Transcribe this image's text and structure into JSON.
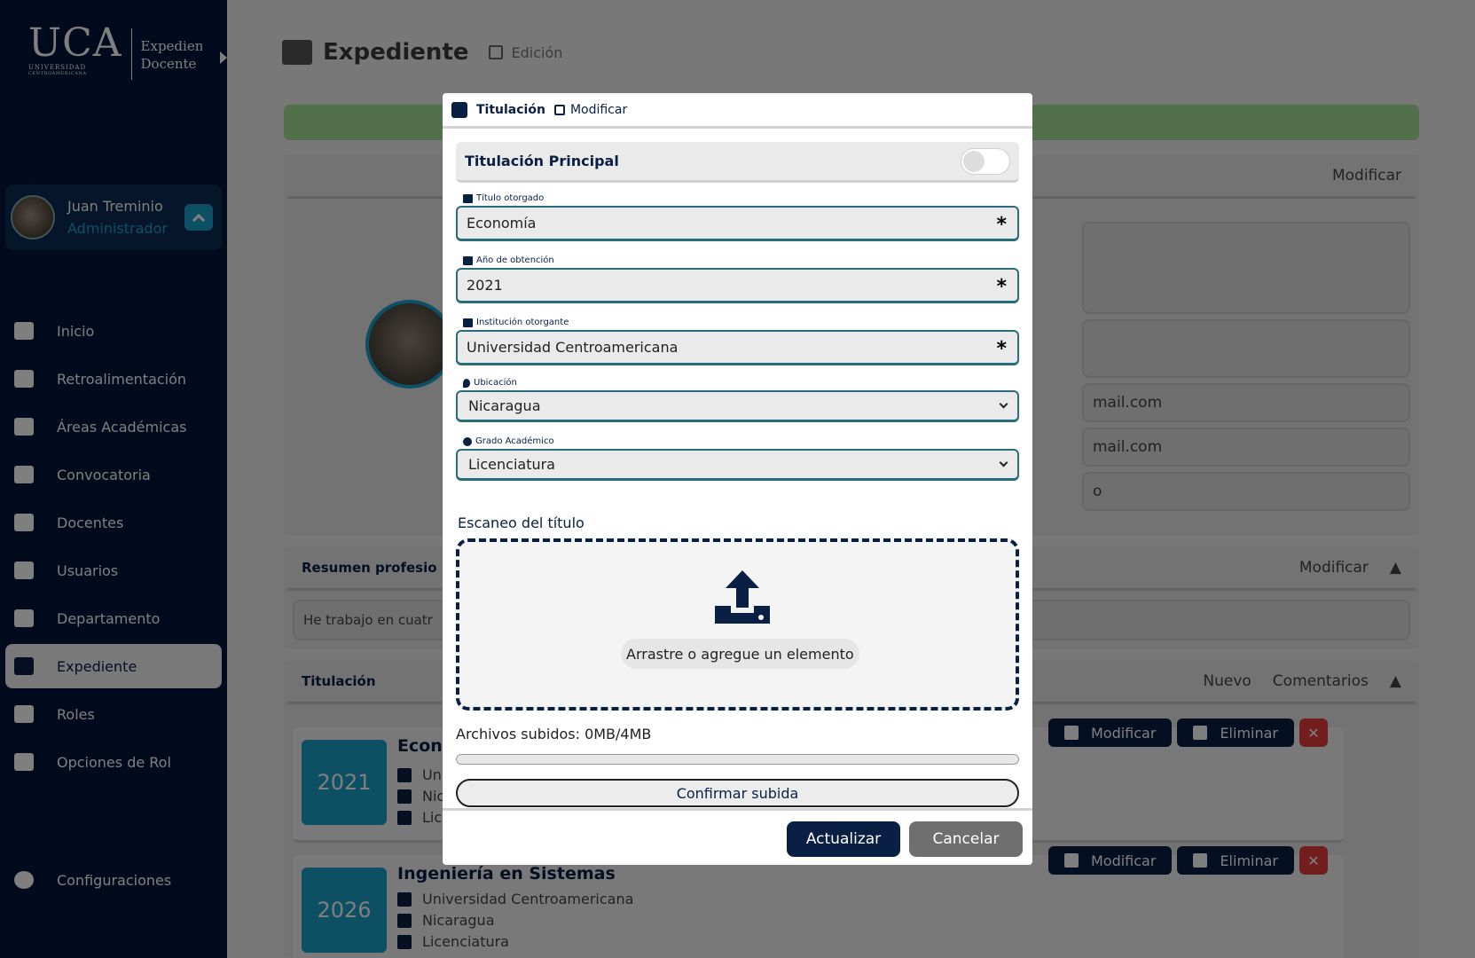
{
  "brand": {
    "logo_text": "UCA",
    "logo_sub": "UNIVERSIDAD",
    "logo_sub2": "CENTROAMERICANA",
    "app_line1": "Expediente",
    "app_line2": "Docente"
  },
  "user": {
    "name": "Juan Treminio",
    "role": "Administrador"
  },
  "nav": {
    "items": [
      {
        "label": "Inicio",
        "icon": "columns-icon"
      },
      {
        "label": "Retroalimentación",
        "icon": "book-icon"
      },
      {
        "label": "Áreas Académicas",
        "icon": "graduation-cap-icon"
      },
      {
        "label": "Convocatoria",
        "icon": "megaphone-icon"
      },
      {
        "label": "Docentes",
        "icon": "chalkboard-teacher-icon"
      },
      {
        "label": "Usuarios",
        "icon": "users-icon"
      },
      {
        "label": "Departamento",
        "icon": "building-icon"
      },
      {
        "label": "Expediente",
        "icon": "folder-open-icon",
        "active": true
      },
      {
        "label": "Roles",
        "icon": "scroll-icon"
      },
      {
        "label": "Opciones de Rol",
        "icon": "scroll-icon"
      }
    ],
    "settings": "Configuraciones"
  },
  "page": {
    "title": "Expediente",
    "subtitle": "Edición"
  },
  "background": {
    "modify": "Modificar",
    "email1": "mail.com",
    "email2": "mail.com",
    "partial": "o",
    "summary_title": "Resumen profesio",
    "summary_text": "He trabajo en cuatr",
    "titulacion_title": "Titulación",
    "new": "Nuevo",
    "comments": "Comentarios",
    "delete": "Eliminar",
    "entries": [
      {
        "year": "2021",
        "title": "Econ",
        "institution": "Uni",
        "location": "Nic",
        "degree": "Lic"
      },
      {
        "year": "2026",
        "title": "Ingeniería en Sistemas",
        "institution": "Universidad Centroamericana",
        "location": "Nicaragua",
        "degree": "Licenciatura"
      }
    ]
  },
  "modal": {
    "title": "Titulación",
    "mode": "Modificar",
    "principal_label": "Titulación Principal",
    "principal_on": false,
    "fields": {
      "titulo": {
        "label": "Título otorgado",
        "value": "Economía"
      },
      "anio": {
        "label": "Año de obtención",
        "value": "2021"
      },
      "institucion": {
        "label": "Institución otorgante",
        "value": "Universidad Centroamericana"
      },
      "ubicacion": {
        "label": "Ubicación",
        "value": "Nicaragua"
      },
      "grado": {
        "label": "Grado Académico",
        "value": "Licenciatura"
      }
    },
    "required_mark": "*",
    "scan_label": "Escaneo del título",
    "drop_text": "Arrastre o agregue un elemento",
    "files_text": "Archivos subidos: 0MB/4MB",
    "upload_progress": 0,
    "confirm": "Confirmar subida",
    "update": "Actualizar",
    "cancel": "Cancelar"
  },
  "colors": {
    "navy": "#0a1f44",
    "accent": "#1aa0c8",
    "danger": "#e43d3d",
    "success": "#a6e09a"
  }
}
